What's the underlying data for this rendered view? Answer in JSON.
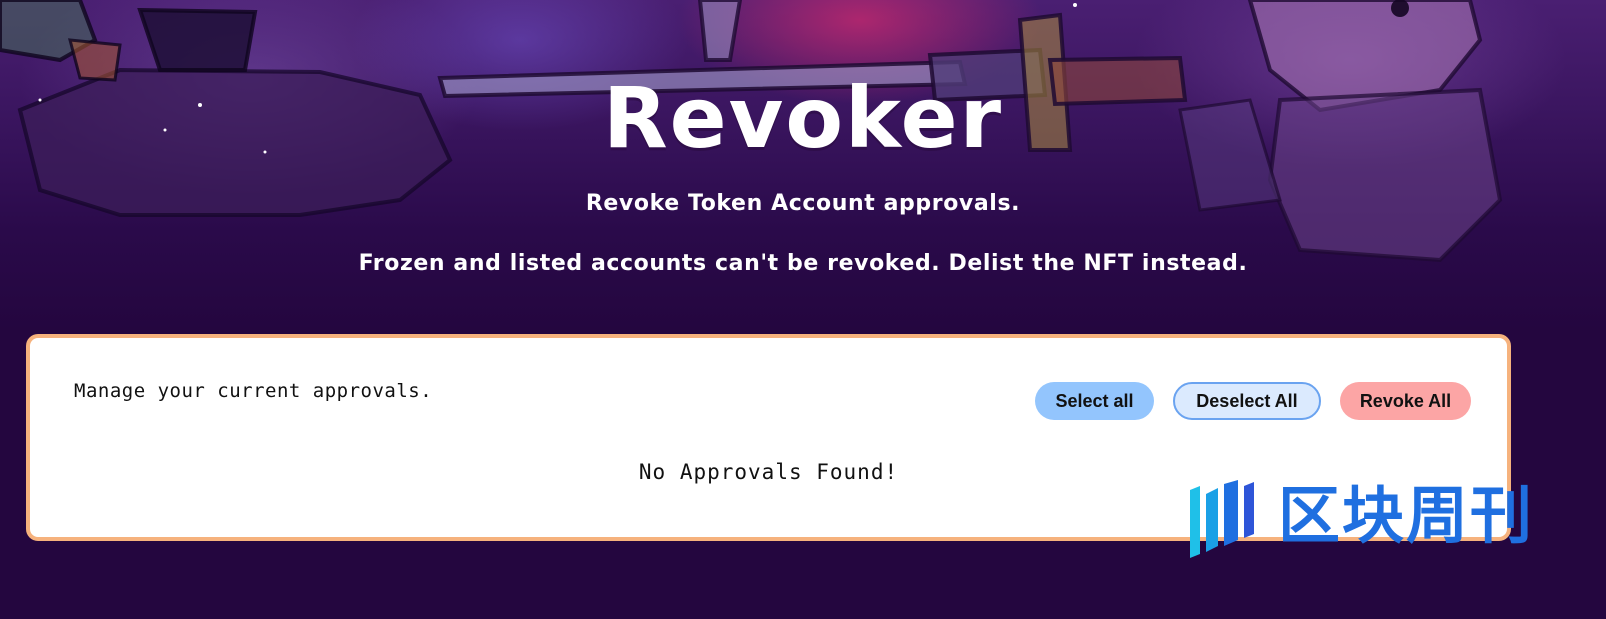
{
  "hero": {
    "title": "Revoker",
    "subtitle_1": "Revoke Token Account approvals.",
    "subtitle_2": "Frozen and listed accounts can't be revoked. Delist the NFT instead."
  },
  "panel": {
    "manage_text": "Manage your current approvals.",
    "buttons": {
      "select_all": "Select all",
      "deselect_all": "Deselect All",
      "revoke_all": "Revoke All"
    },
    "empty_message": "No Approvals Found!"
  },
  "watermark": {
    "text": "区块周刊",
    "icon": "bars-logo-icon"
  },
  "colors": {
    "page_background": "#24063f",
    "card_border": "#f6b27d",
    "select_button": "#93c5fd",
    "deselect_button": "#dbeafe",
    "revoke_button": "#fca5a5",
    "watermark": "#1f6fe0"
  }
}
